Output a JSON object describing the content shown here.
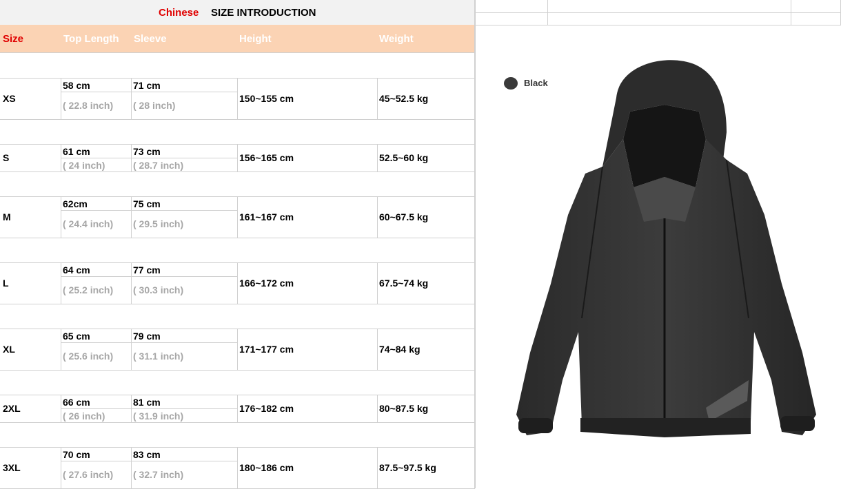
{
  "title": {
    "chinese": "Chinese",
    "intro": "SIZE INTRODUCTION"
  },
  "headers": {
    "size": "Size",
    "top_length": "Top Length",
    "sleeve": "Sleeve",
    "height": "Height",
    "weight": "Weight"
  },
  "rows": [
    {
      "size": "XS",
      "top_cm": "58 cm",
      "top_in": "( 22.8 inch)",
      "sleeve_cm": "71 cm",
      "sleeve_in": "( 28 inch)",
      "height": "150~155 cm",
      "weight": "45~52.5 kg"
    },
    {
      "size": "S",
      "top_cm": "61 cm",
      "top_in": "( 24 inch)",
      "sleeve_cm": "73 cm",
      "sleeve_in": "( 28.7 inch)",
      "height": "156~165 cm",
      "weight": "52.5~60 kg"
    },
    {
      "size": "M",
      "top_cm": "62cm",
      "top_in": "( 24.4 inch)",
      "sleeve_cm": "75 cm",
      "sleeve_in": "( 29.5 inch)",
      "height": "161~167 cm",
      "weight": "60~67.5 kg"
    },
    {
      "size": "L",
      "top_cm": "64 cm",
      "top_in": "( 25.2 inch)",
      "sleeve_cm": "77 cm",
      "sleeve_in": "( 30.3 inch)",
      "height": "166~172 cm",
      "weight": "67.5~74 kg"
    },
    {
      "size": "XL",
      "top_cm": "65 cm",
      "top_in": "( 25.6 inch)",
      "sleeve_cm": "79 cm",
      "sleeve_in": "( 31.1 inch)",
      "height": "171~177 cm",
      "weight": "74~84 kg"
    },
    {
      "size": "2XL",
      "top_cm": "66 cm",
      "top_in": "( 26 inch)",
      "sleeve_cm": "81 cm",
      "sleeve_in": "( 31.9 inch)",
      "height": "176~182 cm",
      "weight": "80~87.5 kg"
    },
    {
      "size": "3XL",
      "top_cm": "70 cm",
      "top_in": "( 27.6 inch)",
      "sleeve_cm": "83 cm",
      "sleeve_in": "( 32.7 inch)",
      "height": "180~186 cm",
      "weight": "87.5~97.5 kg"
    }
  ],
  "legend": {
    "color_label": "Black",
    "swatch": "#3a3a3a"
  },
  "colors": {
    "header_bg": "#fbd3b4",
    "accent_red": "#e00000",
    "inch_gray": "#a6a6a6"
  }
}
